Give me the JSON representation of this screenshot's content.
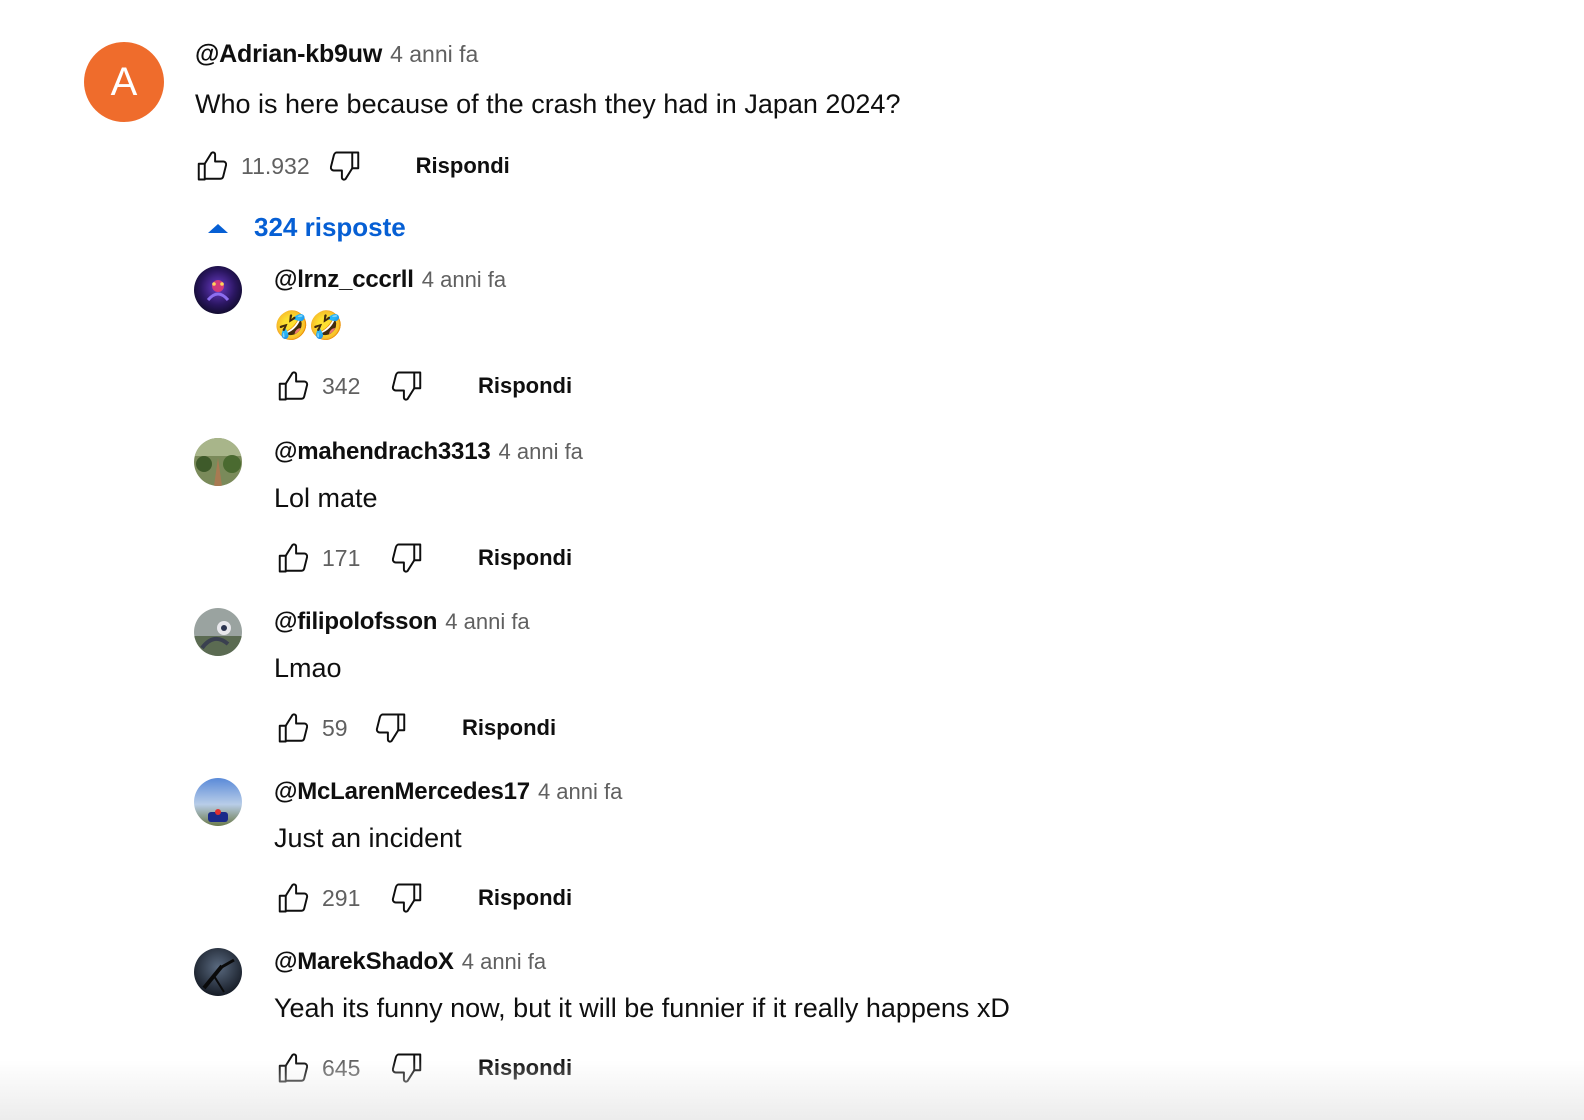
{
  "top_comment": {
    "avatar_letter": "A",
    "avatar_color": "#ef6c2c",
    "handle": "@Adrian-kb9uw",
    "time": "4 anni fa",
    "text": "Who is here because of the crash they had in Japan 2024?",
    "likes": "11.932",
    "reply_label": "Rispondi"
  },
  "replies_toggle": {
    "label": "324 risposte",
    "icon": "caret-up-icon",
    "color": "#065fd4"
  },
  "replies": [
    {
      "handle": "@lrnz_cccrll",
      "time": "4 anni fa",
      "text": "🤣🤣",
      "likes": "342",
      "reply_label": "Rispondi"
    },
    {
      "handle": "@mahendrach3313",
      "time": "4 anni fa",
      "text": "Lol mate",
      "likes": "171",
      "reply_label": "Rispondi"
    },
    {
      "handle": "@filipolofsson",
      "time": "4 anni fa",
      "text": "Lmao",
      "likes": "59",
      "reply_label": "Rispondi"
    },
    {
      "handle": "@McLarenMercedes17",
      "time": "4 anni fa",
      "text": "Just an incident",
      "likes": "291",
      "reply_label": "Rispondi"
    },
    {
      "handle": "@MarekShadoX",
      "time": "4 anni fa",
      "text": "Yeah its funny now, but it will be funnier if it really happens xD",
      "likes": "645",
      "reply_label": "Rispondi"
    }
  ]
}
